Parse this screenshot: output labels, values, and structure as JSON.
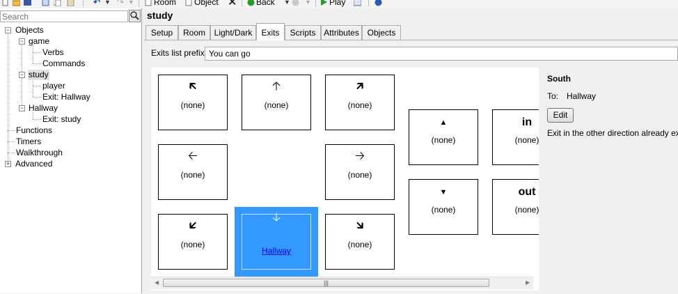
{
  "toolbar": {
    "room_label": "Room",
    "object_label": "Object",
    "back_label": "Back",
    "play_label": "Play"
  },
  "sidebar": {
    "search_placeholder": "Search",
    "tree": {
      "objects": "Objects",
      "game": "game",
      "verbs": "Verbs",
      "commands": "Commands",
      "study": "study",
      "player": "player",
      "exit_hallway": "Exit: Hallway",
      "hallway": "Hallway",
      "exit_study": "Exit: study",
      "functions": "Functions",
      "timers": "Timers",
      "walkthrough": "Walkthrough",
      "advanced": "Advanced"
    }
  },
  "main": {
    "title": "study",
    "tabs": [
      "Setup",
      "Room",
      "Light/Dark",
      "Exits",
      "Scripts",
      "Attributes",
      "Objects"
    ],
    "active_tab": "Exits",
    "exits_prefix_label": "Exits list prefix:",
    "exits_prefix_value": "You can go",
    "exits": {
      "northwest": {
        "arrow": "🡴",
        "value": "(none)"
      },
      "north": {
        "arrow": "🡡",
        "value": "(none)"
      },
      "northeast": {
        "arrow": "🡵",
        "value": "(none)"
      },
      "west": {
        "arrow": "🡠",
        "value": "(none)"
      },
      "east": {
        "arrow": "🡢",
        "value": "(none)"
      },
      "southwest": {
        "arrow": "🡷",
        "value": "(none)"
      },
      "south": {
        "arrow": "🡣",
        "value": "Hallway"
      },
      "southeast": {
        "arrow": "🡶",
        "value": "(none)"
      },
      "up": {
        "arrow": "▲",
        "value": "(none)"
      },
      "down": {
        "arrow": "▼",
        "value": "(none)"
      },
      "in": {
        "arrow": "in",
        "value": "(none)"
      },
      "out": {
        "arrow": "out",
        "value": "(none)"
      }
    },
    "scroll_grip": "|||"
  },
  "detail": {
    "title": "South",
    "to_label": "To:",
    "to_value": "Hallway",
    "edit_label": "Edit",
    "message": "Exit in the other direction already exists"
  },
  "colors": {
    "selected_exit": "#3399ff",
    "link": "#0000ee"
  }
}
